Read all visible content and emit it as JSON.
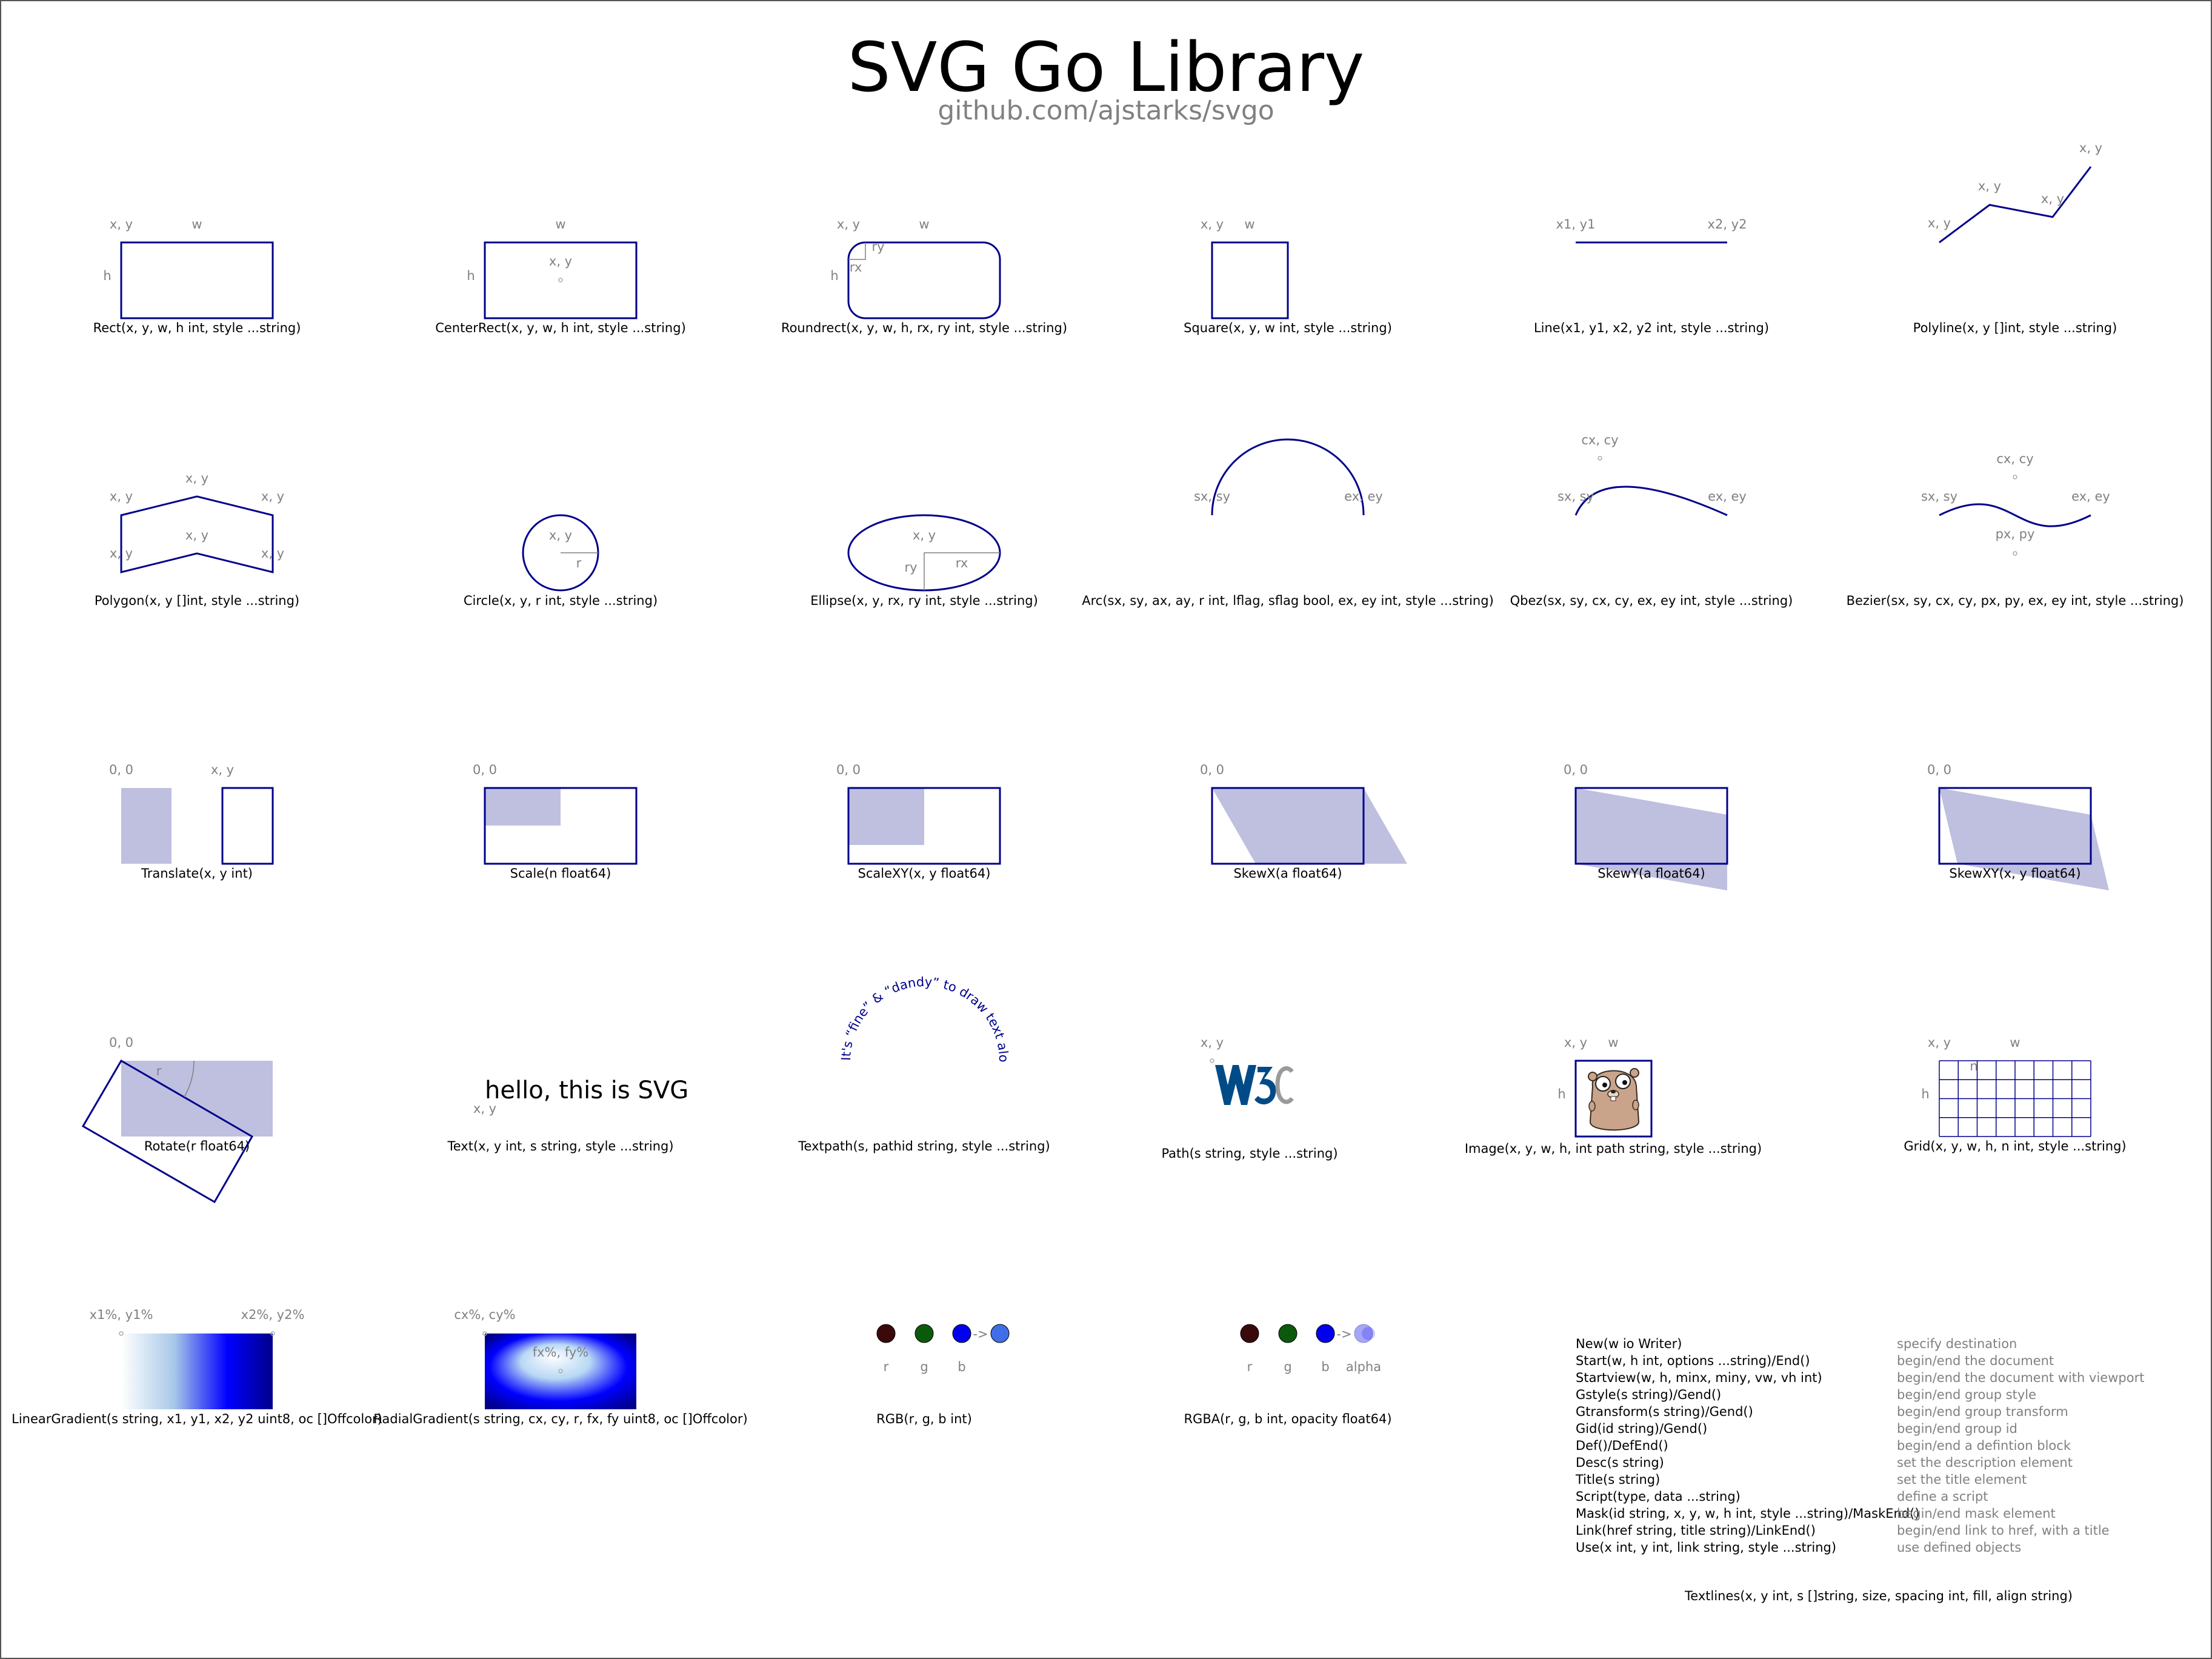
{
  "header": {
    "title": "SVG Go Library",
    "subtitle": "github.com/ajstarks/svgo"
  },
  "captions": {
    "rect": "Rect(x, y, w, h int, style ...string)",
    "centerrect": "CenterRect(x, y, w, h int, style ...string)",
    "roundrect": "Roundrect(x, y, w, h, rx, ry int, style ...string)",
    "square": "Square(x, y, w int, style ...string)",
    "line": "Line(x1, y1, x2, y2 int, style ...string)",
    "polyline": "Polyline(x, y []int, style ...string)",
    "polygon": "Polygon(x, y []int, style ...string)",
    "circle": "Circle(x, y, r int, style ...string)",
    "ellipse": "Ellipse(x, y, rx, ry int, style ...string)",
    "arc": "Arc(sx, sy, ax, ay, r int, lflag, sflag bool, ex, ey int, style ...string)",
    "qbez": "Qbez(sx, sy, cx, cy, ex, ey int, style ...string)",
    "bezier": "Bezier(sx, sy, cx, cy, px, py, ex, ey int, style ...string)",
    "translate": "Translate(x, y int)",
    "scale": "Scale(n float64)",
    "scalexy": "ScaleXY(x, y float64)",
    "skewx": "SkewX(a float64)",
    "skewy": "SkewY(a float64)",
    "skewxy": "SkewXY(x, y float64)",
    "rotate": "Rotate(r float64)",
    "text": "Text(x, y int, s string, style ...string)",
    "textpath": "Textpath(s, pathid string, style ...string)",
    "path": "Path(s string, style ...string)",
    "image": "Image(x, y, w, h, int path string, style ...string)",
    "grid": "Grid(x, y, w, h, n int, style ...string)",
    "lineargradient": "LinearGradient(s string, x1, y1, x2, y2 uint8, oc []Offcolor)",
    "radialgradient": "RadialGradient(s string, cx, cy, r, fx, fy uint8, oc []Offcolor)",
    "rgb": "RGB(r, g, b int)",
    "rgba": "RGBA(r, g, b int, opacity float64)",
    "textlines": "Textlines(x, y int, s []string, size, spacing int, fill, align string)"
  },
  "labels": {
    "xy": "x, y",
    "w": "w",
    "h": "h",
    "rx": "rx",
    "ry": "ry",
    "r": "r",
    "x1y1": "x1, y1",
    "x2y2": "x2, y2",
    "sxsy": "sx, sy",
    "exey": "ex, ey",
    "cxcy": "cx, cy",
    "pxpy": "px, py",
    "origin": "0, 0",
    "n": "n",
    "lin_start": "x1%, y1%",
    "lin_end": "x2%, y2%",
    "rad_center": "cx%, cy%",
    "rad_focus": "fx%, fy%",
    "color_r": "r",
    "color_g": "g",
    "color_b": "b",
    "alpha": "alpha",
    "arrow": "->"
  },
  "demo": {
    "hello_text": "hello, this is SVG",
    "textpath_text": "It's “fine” & “dandy” to draw text along a path",
    "w3c_logo": "W3C"
  },
  "colors": {
    "stroke": "#00008b",
    "fill": "#9c9cd0",
    "label_gray": "#808080",
    "dot_dark_red": "#3a0a0a",
    "dot_green": "#0b5a0b",
    "dot_blue": "#0000ee",
    "dot_blue_light": "#3f6ee8"
  },
  "api_list": [
    {
      "sig": "New(w io Writer)",
      "desc": "specify destination"
    },
    {
      "sig": "Start(w, h int, options ...string)/End()",
      "desc": "begin/end the document"
    },
    {
      "sig": "Startview(w, h, minx, miny, vw, vh int)",
      "desc": "begin/end the document with viewport"
    },
    {
      "sig": "Gstyle(s string)/Gend()",
      "desc": "begin/end group style"
    },
    {
      "sig": "Gtransform(s string)/Gend()",
      "desc": "begin/end group transform"
    },
    {
      "sig": "Gid(id string)/Gend()",
      "desc": "begin/end group id"
    },
    {
      "sig": "Def()/DefEnd()",
      "desc": "begin/end a defintion block"
    },
    {
      "sig": "Desc(s string)",
      "desc": "set the description element"
    },
    {
      "sig": "Title(s string)",
      "desc": "set the title element"
    },
    {
      "sig": "Script(type, data ...string)",
      "desc": "define a script"
    },
    {
      "sig": "Mask(id string, x, y, w, h int, style ...string)/MaskEnd()",
      "desc": "begin/end mask element"
    },
    {
      "sig": "Link(href string, title string)/LinkEnd()",
      "desc": "begin/end link to href, with a title"
    },
    {
      "sig": "Use(x int, y int, link string, style ...string)",
      "desc": "use defined objects"
    }
  ]
}
